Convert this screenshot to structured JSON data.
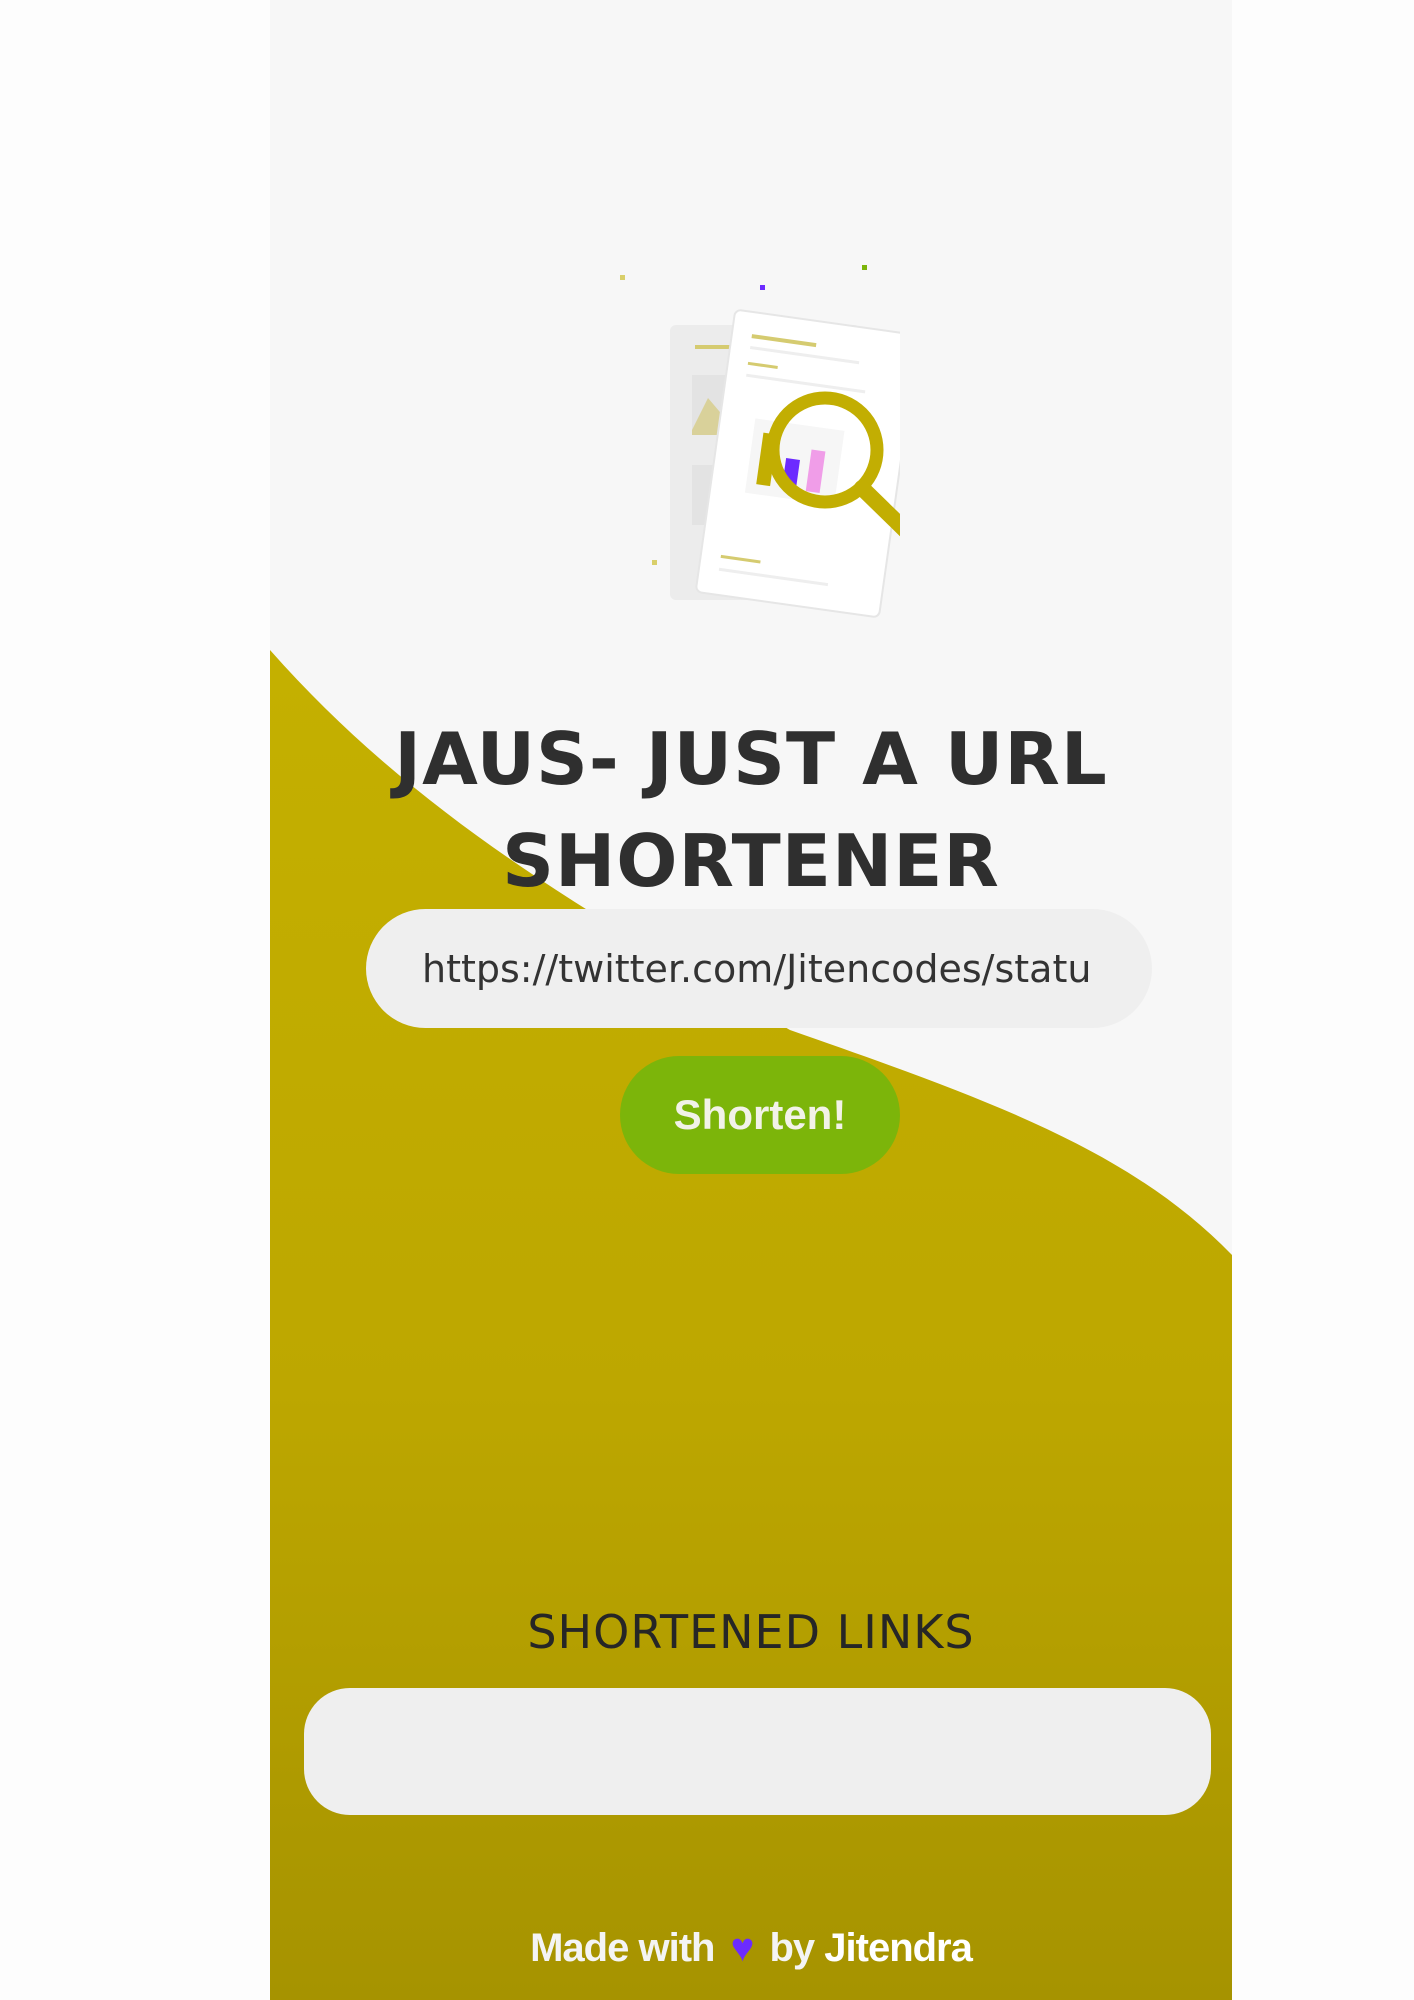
{
  "app": {
    "title_line1": "JAUS- JUST A URL",
    "title_line2": "SHORTENER"
  },
  "form": {
    "url_value": "https://twitter.com/Jitencodes/statu",
    "submit_label": "Shorten!"
  },
  "results": {
    "heading": "SHORTENED LINKS"
  },
  "footer": {
    "made_with": "Made with",
    "heart_glyph": "♥",
    "by": "by",
    "author": "Jitendra"
  },
  "colors": {
    "accent_olive": "#c2ae02",
    "button_green": "#7cb50a",
    "heart_purple": "#6c2bff",
    "panel_bg": "#f7f7f7"
  },
  "icons": {
    "illustration": "document-search-illustration",
    "heart": "heart-icon"
  }
}
